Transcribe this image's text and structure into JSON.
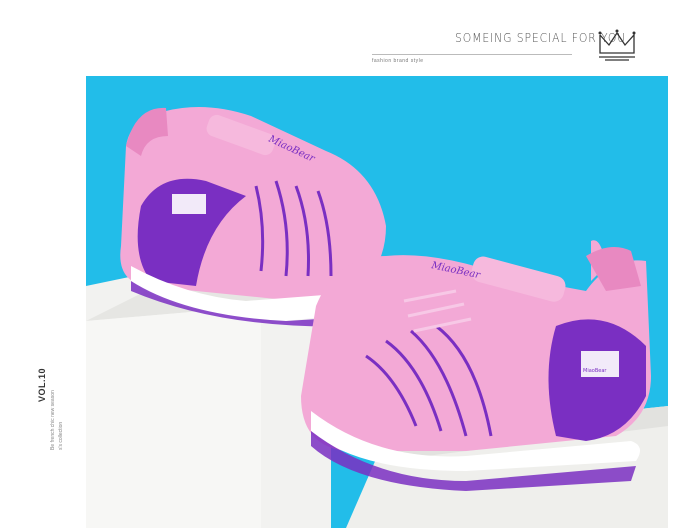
{
  "header": {
    "title": "SOMEING SPECIAL FOR YOU",
    "subtitle": "fashion brand style",
    "crown_icon": "crown-icon"
  },
  "side": {
    "vol": "VOL.10",
    "line1": "Be french chic new season",
    "line2": "s's collection"
  },
  "photo": {
    "background": "#22bde9",
    "shoe_primary": "#f3a9d6",
    "shoe_accent": "#7a2fc2",
    "sole": "#ffffff",
    "shoe_text": "MiaoBear",
    "shoe_logo_text": "MiaoBear"
  }
}
